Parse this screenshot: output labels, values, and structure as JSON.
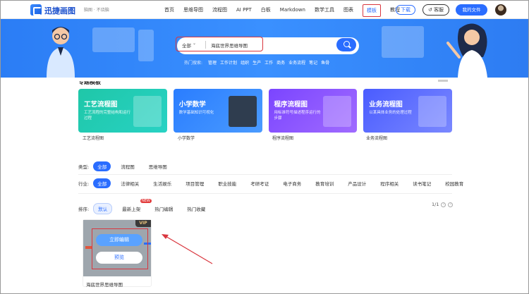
{
  "header": {
    "brand": "迅捷画图",
    "slogan": "脑图 · 不烧脑",
    "nav": [
      "首页",
      "思维导图",
      "流程图",
      "AI PPT",
      "白板",
      "Markdown",
      "数学工具",
      "图表",
      "模板",
      "教程"
    ],
    "nav_active": "模板",
    "download_label": "下载",
    "help_label": "客服",
    "files_label": "我的文件"
  },
  "search": {
    "type": "全部",
    "value": "海底世界思维导图",
    "hot_label": "热门搜索:",
    "hot": [
      "管理",
      "工作计划",
      "组织",
      "生产",
      "工作",
      "商务",
      "业务流程",
      "笔记",
      "鱼骨"
    ]
  },
  "section": {
    "title": "专题模板"
  },
  "cards": [
    {
      "title": "工艺流程图",
      "desc": "工艺流程的完整结构和运行过程",
      "label": "工艺流程图",
      "color": "#20c9b3"
    },
    {
      "title": "小学数学",
      "desc": "数学基础知识可视化",
      "label": "小学数学",
      "color": "#2f8bff"
    },
    {
      "title": "程序流程图",
      "desc": "用标准符号描述程序运行的步骤",
      "label": "程序流程图",
      "color": "#8a4dff"
    },
    {
      "title": "业务流程图",
      "desc": "以某具体业务的处理过程",
      "label": "业务流程图",
      "color": "#5b6cff"
    }
  ],
  "filters": {
    "type_label": "类型:",
    "types": [
      "全部",
      "流程图",
      "思维导图"
    ],
    "industry_label": "行业:",
    "industries": [
      "全部",
      "法律相关",
      "生活娱乐",
      "项目管理",
      "职业技能",
      "考研考证",
      "电子商务",
      "教育培训",
      "产品设计",
      "程序相关",
      "读书笔记",
      "校园教育"
    ]
  },
  "sort": {
    "label": "排序:",
    "options": [
      "默认",
      "最新上架",
      "热门编辑",
      "热门收藏"
    ],
    "new_badge": "NEW"
  },
  "pager": {
    "text": "1/1",
    "prev": "‹",
    "next": "›"
  },
  "template": {
    "name": "海底世界思维导图",
    "vip": "VIP",
    "edit_label": "立即编辑",
    "preview_label": "预览"
  }
}
